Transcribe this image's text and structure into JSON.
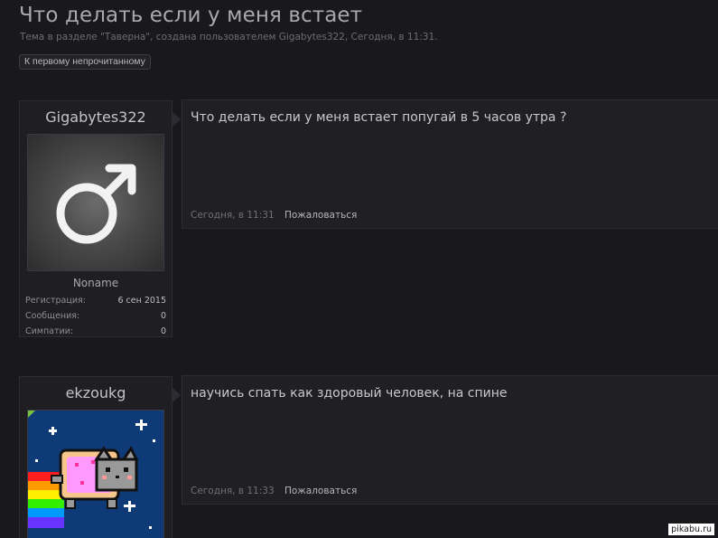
{
  "thread": {
    "title": "Что делать если у меня встает",
    "subtitle": "Тема в разделе \"Таверна\", создана пользователем Gigabytes322, Сегодня, в 11:31.",
    "first_unread_label": "К первому непрочитанному"
  },
  "posts": [
    {
      "username": "Gigabytes322",
      "role": "Noname",
      "stats": [
        {
          "label": "Регистрация:",
          "value": "6 сен 2015"
        },
        {
          "label": "Сообщения:",
          "value": "0"
        },
        {
          "label": "Симпатии:",
          "value": "0"
        }
      ],
      "text": "Что делать если у меня встает попугай в 5 часов утра ?",
      "date": "Сегодня, в 11:31",
      "report_label": "Пожаловаться"
    },
    {
      "username": "ekzoukg",
      "text": "научись спать как здоровый человек, на спине",
      "date": "Сегодня, в 11:33",
      "report_label": "Пожаловаться"
    }
  ],
  "watermark": "pikabu.ru"
}
